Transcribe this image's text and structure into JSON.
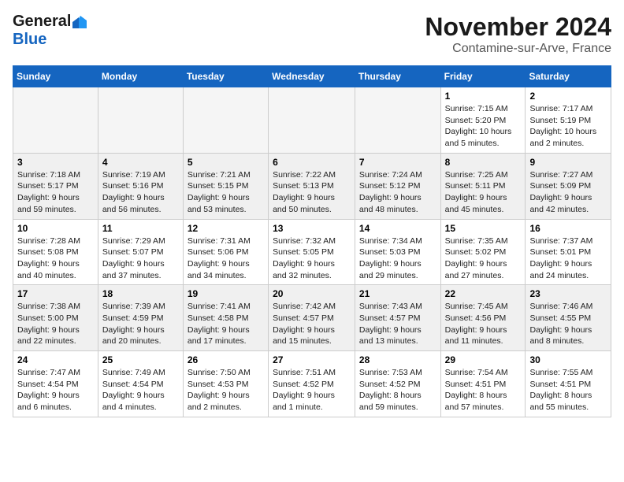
{
  "header": {
    "logo_line1": "General",
    "logo_line2": "Blue",
    "month": "November 2024",
    "location": "Contamine-sur-Arve, France"
  },
  "weekdays": [
    "Sunday",
    "Monday",
    "Tuesday",
    "Wednesday",
    "Thursday",
    "Friday",
    "Saturday"
  ],
  "weeks": [
    [
      {
        "day": "",
        "info": ""
      },
      {
        "day": "",
        "info": ""
      },
      {
        "day": "",
        "info": ""
      },
      {
        "day": "",
        "info": ""
      },
      {
        "day": "",
        "info": ""
      },
      {
        "day": "1",
        "info": "Sunrise: 7:15 AM\nSunset: 5:20 PM\nDaylight: 10 hours\nand 5 minutes."
      },
      {
        "day": "2",
        "info": "Sunrise: 7:17 AM\nSunset: 5:19 PM\nDaylight: 10 hours\nand 2 minutes."
      }
    ],
    [
      {
        "day": "3",
        "info": "Sunrise: 7:18 AM\nSunset: 5:17 PM\nDaylight: 9 hours\nand 59 minutes."
      },
      {
        "day": "4",
        "info": "Sunrise: 7:19 AM\nSunset: 5:16 PM\nDaylight: 9 hours\nand 56 minutes."
      },
      {
        "day": "5",
        "info": "Sunrise: 7:21 AM\nSunset: 5:15 PM\nDaylight: 9 hours\nand 53 minutes."
      },
      {
        "day": "6",
        "info": "Sunrise: 7:22 AM\nSunset: 5:13 PM\nDaylight: 9 hours\nand 50 minutes."
      },
      {
        "day": "7",
        "info": "Sunrise: 7:24 AM\nSunset: 5:12 PM\nDaylight: 9 hours\nand 48 minutes."
      },
      {
        "day": "8",
        "info": "Sunrise: 7:25 AM\nSunset: 5:11 PM\nDaylight: 9 hours\nand 45 minutes."
      },
      {
        "day": "9",
        "info": "Sunrise: 7:27 AM\nSunset: 5:09 PM\nDaylight: 9 hours\nand 42 minutes."
      }
    ],
    [
      {
        "day": "10",
        "info": "Sunrise: 7:28 AM\nSunset: 5:08 PM\nDaylight: 9 hours\nand 40 minutes."
      },
      {
        "day": "11",
        "info": "Sunrise: 7:29 AM\nSunset: 5:07 PM\nDaylight: 9 hours\nand 37 minutes."
      },
      {
        "day": "12",
        "info": "Sunrise: 7:31 AM\nSunset: 5:06 PM\nDaylight: 9 hours\nand 34 minutes."
      },
      {
        "day": "13",
        "info": "Sunrise: 7:32 AM\nSunset: 5:05 PM\nDaylight: 9 hours\nand 32 minutes."
      },
      {
        "day": "14",
        "info": "Sunrise: 7:34 AM\nSunset: 5:03 PM\nDaylight: 9 hours\nand 29 minutes."
      },
      {
        "day": "15",
        "info": "Sunrise: 7:35 AM\nSunset: 5:02 PM\nDaylight: 9 hours\nand 27 minutes."
      },
      {
        "day": "16",
        "info": "Sunrise: 7:37 AM\nSunset: 5:01 PM\nDaylight: 9 hours\nand 24 minutes."
      }
    ],
    [
      {
        "day": "17",
        "info": "Sunrise: 7:38 AM\nSunset: 5:00 PM\nDaylight: 9 hours\nand 22 minutes."
      },
      {
        "day": "18",
        "info": "Sunrise: 7:39 AM\nSunset: 4:59 PM\nDaylight: 9 hours\nand 20 minutes."
      },
      {
        "day": "19",
        "info": "Sunrise: 7:41 AM\nSunset: 4:58 PM\nDaylight: 9 hours\nand 17 minutes."
      },
      {
        "day": "20",
        "info": "Sunrise: 7:42 AM\nSunset: 4:57 PM\nDaylight: 9 hours\nand 15 minutes."
      },
      {
        "day": "21",
        "info": "Sunrise: 7:43 AM\nSunset: 4:57 PM\nDaylight: 9 hours\nand 13 minutes."
      },
      {
        "day": "22",
        "info": "Sunrise: 7:45 AM\nSunset: 4:56 PM\nDaylight: 9 hours\nand 11 minutes."
      },
      {
        "day": "23",
        "info": "Sunrise: 7:46 AM\nSunset: 4:55 PM\nDaylight: 9 hours\nand 8 minutes."
      }
    ],
    [
      {
        "day": "24",
        "info": "Sunrise: 7:47 AM\nSunset: 4:54 PM\nDaylight: 9 hours\nand 6 minutes."
      },
      {
        "day": "25",
        "info": "Sunrise: 7:49 AM\nSunset: 4:54 PM\nDaylight: 9 hours\nand 4 minutes."
      },
      {
        "day": "26",
        "info": "Sunrise: 7:50 AM\nSunset: 4:53 PM\nDaylight: 9 hours\nand 2 minutes."
      },
      {
        "day": "27",
        "info": "Sunrise: 7:51 AM\nSunset: 4:52 PM\nDaylight: 9 hours\nand 1 minute."
      },
      {
        "day": "28",
        "info": "Sunrise: 7:53 AM\nSunset: 4:52 PM\nDaylight: 8 hours\nand 59 minutes."
      },
      {
        "day": "29",
        "info": "Sunrise: 7:54 AM\nSunset: 4:51 PM\nDaylight: 8 hours\nand 57 minutes."
      },
      {
        "day": "30",
        "info": "Sunrise: 7:55 AM\nSunset: 4:51 PM\nDaylight: 8 hours\nand 55 minutes."
      }
    ]
  ]
}
